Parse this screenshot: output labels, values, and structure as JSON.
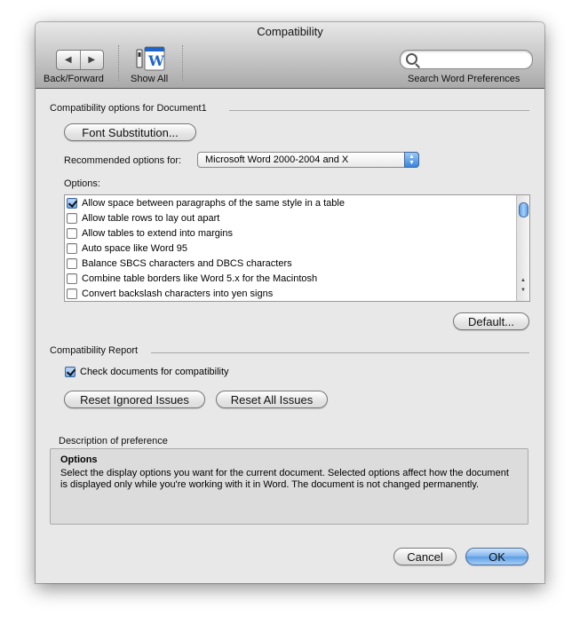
{
  "window": {
    "title": "Compatibility"
  },
  "toolbar": {
    "back_forward_label": "Back/Forward",
    "back_icon": "triangle-left-icon",
    "forward_icon": "triangle-right-icon",
    "show_all_label": "Show All",
    "search_label": "Search Word Preferences",
    "search_placeholder": ""
  },
  "options_section": {
    "title": "Compatibility options for Document1",
    "font_substitution_button": "Font Substitution...",
    "recommended_label": "Recommended options for:",
    "recommended_value": "Microsoft Word 2000-2004 and X",
    "options_label": "Options:",
    "items": [
      {
        "label": "Allow space between paragraphs of the same style in a table",
        "checked": true
      },
      {
        "label": "Allow table rows to lay out apart",
        "checked": false
      },
      {
        "label": "Allow tables to extend into margins",
        "checked": false
      },
      {
        "label": "Auto space like Word 95",
        "checked": false
      },
      {
        "label": "Balance SBCS characters and DBCS characters",
        "checked": false
      },
      {
        "label": "Combine table borders like Word 5.x for the Macintosh",
        "checked": false
      },
      {
        "label": "Convert backslash characters into yen signs",
        "checked": false
      }
    ],
    "default_button": "Default..."
  },
  "report_section": {
    "title": "Compatibility Report",
    "check_label": "Check documents for compatibility",
    "check_checked": true,
    "reset_ignored_button": "Reset Ignored Issues",
    "reset_all_button": "Reset All Issues"
  },
  "description": {
    "title": "Description of preference",
    "heading": "Options",
    "text": "Select the display options you want for the current document. Selected options affect how the document is displayed only while you're working with it in Word. The document is not changed permanently."
  },
  "footer": {
    "cancel_button": "Cancel",
    "ok_button": "OK"
  },
  "colors": {
    "accent": "#5d9de4",
    "window_bg": "#e8e8e8"
  }
}
